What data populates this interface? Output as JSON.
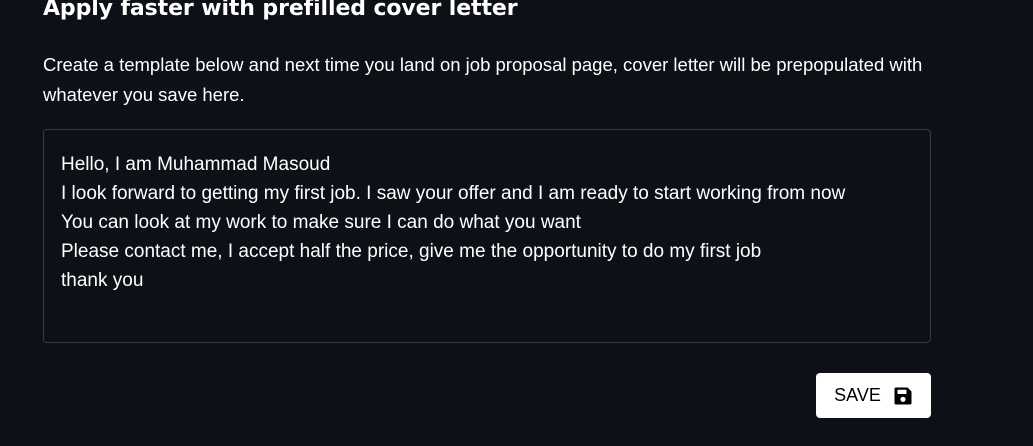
{
  "header": {
    "title": "Apply faster with prefilled cover letter"
  },
  "description": "Create a template below and next time you land on job proposal page, cover letter will be prepopulated with whatever you save here.",
  "cover_letter": {
    "lines": [
      "Hello, I am Muhammad Masoud",
      "I look forward to getting my first job. I saw your offer and I am ready to start working from now",
      "You can look at my work to make sure I can do what you want",
      "Please contact me, I accept half the price, give me the opportunity to do my first job",
      "thank you"
    ]
  },
  "save_button": {
    "label": "SAVE",
    "icon": "floppy-disk-icon"
  },
  "colors": {
    "background": "#0d1017",
    "text": "#ffffff",
    "border": "#363b45",
    "button_bg": "#ffffff",
    "button_text": "#000000"
  }
}
